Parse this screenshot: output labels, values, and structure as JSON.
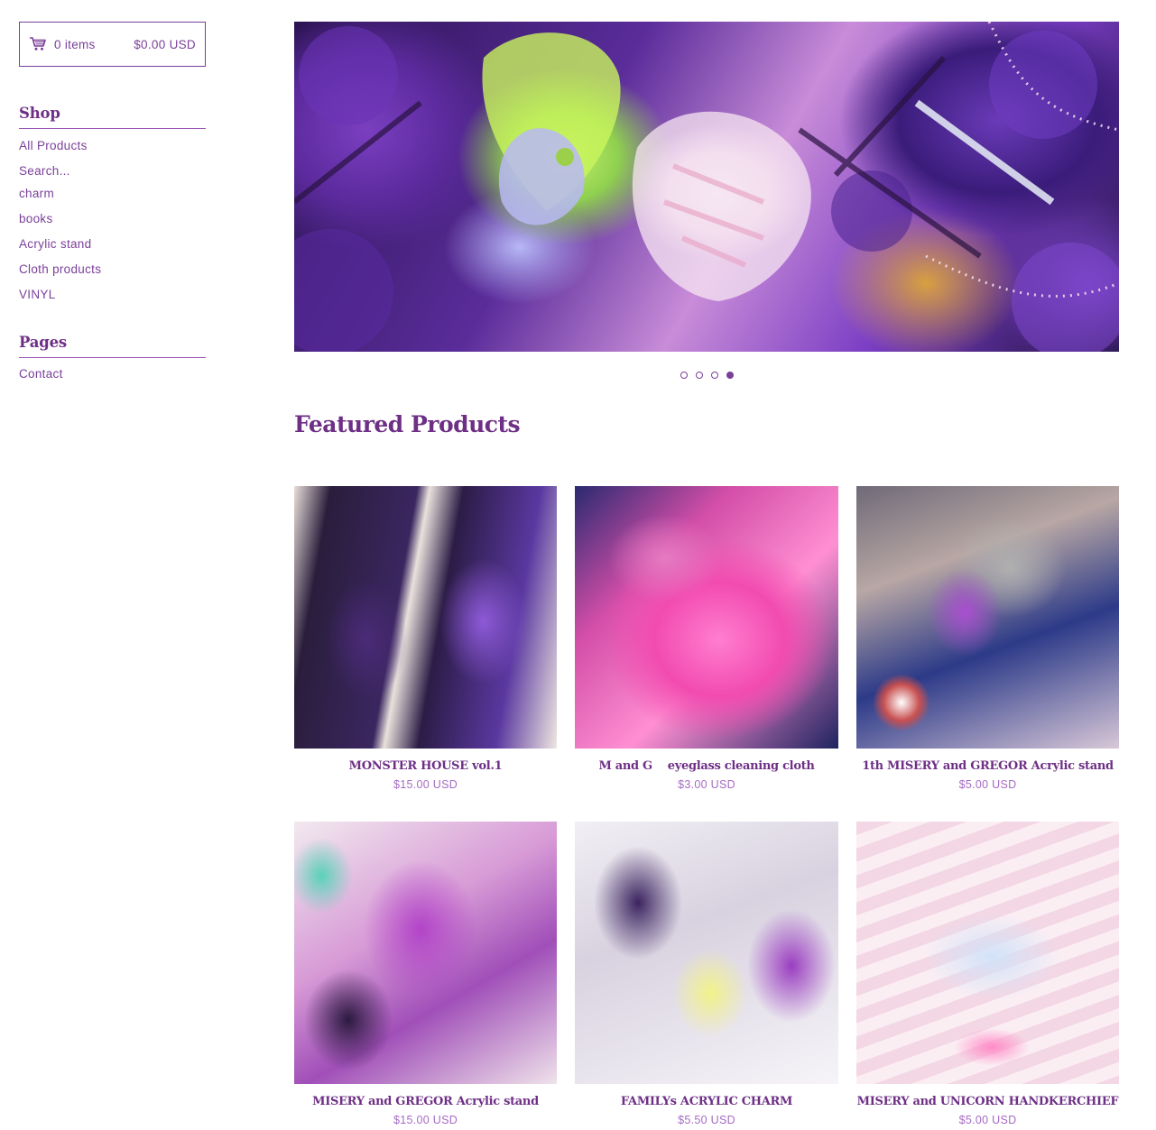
{
  "cart": {
    "icon": "cart-icon",
    "items": "0 items",
    "total": "$0.00 USD"
  },
  "sidebar": {
    "shop_heading": "Shop",
    "shop_items": [
      {
        "label": "All Products"
      },
      {
        "label": "Search..."
      },
      {
        "label": "charm"
      },
      {
        "label": "books"
      },
      {
        "label": "Acrylic stand"
      },
      {
        "label": "Cloth products"
      },
      {
        "label": "VINYL"
      }
    ],
    "pages_heading": "Pages",
    "pages_items": [
      {
        "label": "Contact"
      }
    ]
  },
  "slider": {
    "slide_count": 4,
    "active_slide": 4
  },
  "featured": {
    "title": "Featured Products",
    "products": [
      {
        "name": "MONSTER HOUSE vol.1",
        "price": "$15.00 USD"
      },
      {
        "name": "M and G    eyeglass cleaning cloth",
        "price": "$3.00 USD"
      },
      {
        "name": "1th MISERY and GREGOR Acrylic stand",
        "price": "$5.00 USD"
      },
      {
        "name": "MISERY and GREGOR Acrylic stand",
        "price": "$15.00 USD"
      },
      {
        "name": "FAMILYs ACRYLIC CHARM",
        "price": "$5.50 USD"
      },
      {
        "name": "MISERY and UNICORN HANDKERCHIEF",
        "price": "$5.00 USD"
      }
    ]
  },
  "colors": {
    "accent": "#7a3f9a",
    "heading": "#6e2f86",
    "price": "#a66bc4"
  }
}
